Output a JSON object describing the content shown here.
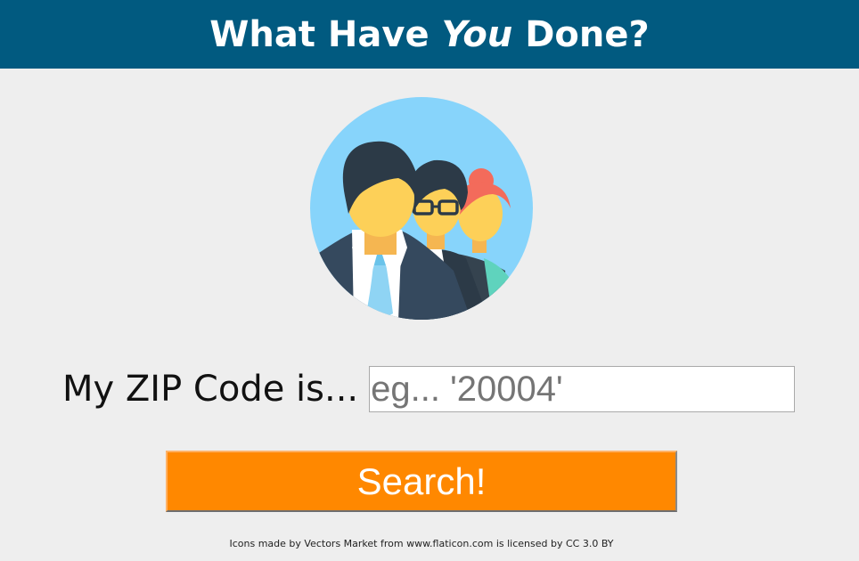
{
  "header": {
    "title_before": "What Have ",
    "title_emphasis": "You",
    "title_after": " Done?",
    "background_color": "#015a80"
  },
  "hero": {
    "icon": "people-group-illustration"
  },
  "zip_form": {
    "label": "My ZIP Code is...",
    "input_value": "",
    "input_placeholder": "eg... '20004'",
    "search_label": "Search!",
    "button_color": "#ff8800"
  },
  "footer": {
    "credit": "Icons made by Vectors Market from www.flaticon.com is licensed by CC 3.0 BY"
  }
}
